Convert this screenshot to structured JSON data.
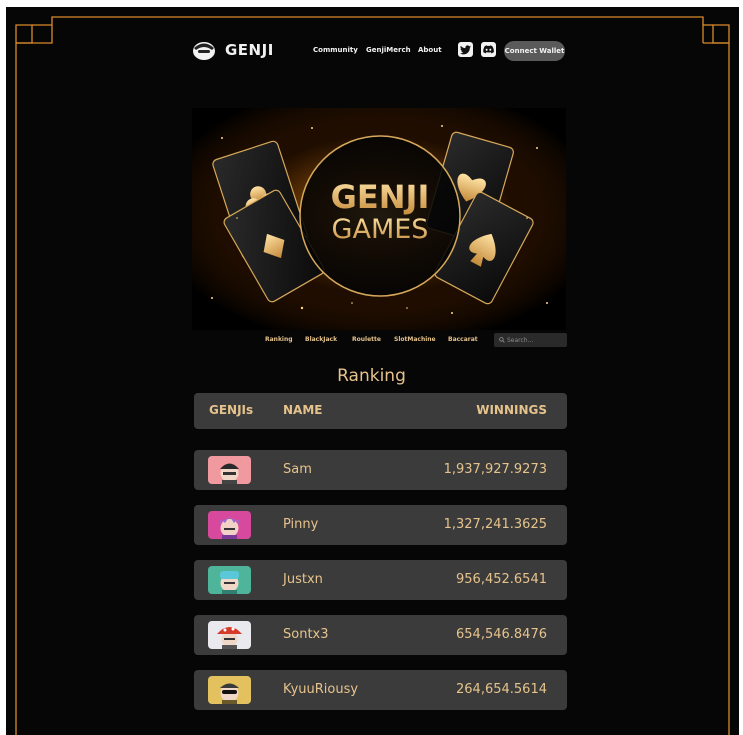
{
  "brand": {
    "name": "GENJI"
  },
  "nav": {
    "links": [
      "Community",
      "GenjiMerch",
      "About"
    ],
    "connect_label": "Connect Wallet"
  },
  "icons": [
    "genji-logo-icon",
    "twitter-icon",
    "discord-icon",
    "search-icon"
  ],
  "hero": {
    "line1": "GENJI",
    "line2": "GAMES"
  },
  "games_menu": {
    "items": [
      "Ranking",
      "BlackJack",
      "Roulette",
      "SlotMachine",
      "Baccarat"
    ],
    "search_placeholder": "Search..."
  },
  "ranking": {
    "title": "Ranking",
    "columns": [
      "GENJIs",
      "NAME",
      "WINNINGS"
    ],
    "rows": [
      {
        "name": "Sam",
        "winnings": "1,937,927.9273",
        "avatar_bg": "#f09aa0"
      },
      {
        "name": "Pinny",
        "winnings": "1,327,241.3625",
        "avatar_bg": "#d6499c"
      },
      {
        "name": "Justxn",
        "winnings": "956,452.6541",
        "avatar_bg": "#4fb59a"
      },
      {
        "name": "Sontx3",
        "winnings": "654,546.8476",
        "avatar_bg": "#e9e9ee"
      },
      {
        "name": "KyuuRiousy",
        "winnings": "264,654.5614",
        "avatar_bg": "#e2c15e"
      }
    ]
  },
  "colors": {
    "gold": "#e6c38c",
    "frame_line": "#d98a2b",
    "panel": "#3b3b3b",
    "background": "#060606"
  }
}
